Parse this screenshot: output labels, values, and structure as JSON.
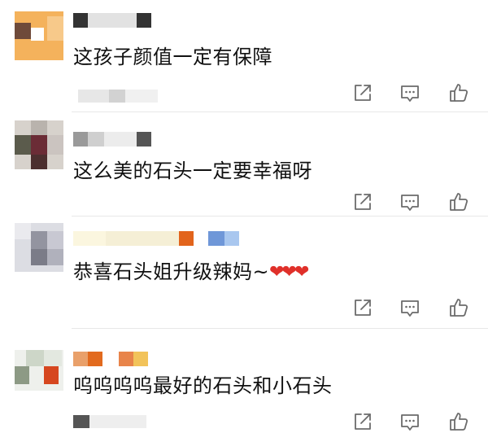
{
  "comments": [
    {
      "text": "这孩子颜值一定有保障",
      "hearts": ""
    },
    {
      "text": "这么美的石头一定要幸福呀",
      "hearts": ""
    },
    {
      "text": "恭喜石头姐升级辣妈~",
      "hearts": "❤❤❤"
    },
    {
      "text": "呜呜呜呜最好的石头和小石头",
      "hearts": ""
    }
  ],
  "actions": {
    "share_icon": "share-icon",
    "reply_icon": "comment-icon",
    "like_icon": "thumbs-up-icon"
  },
  "colors": {
    "text": "#111111",
    "icon": "#6b6b6b",
    "heart": "#e0302a",
    "separator": "#e8e8e8"
  }
}
